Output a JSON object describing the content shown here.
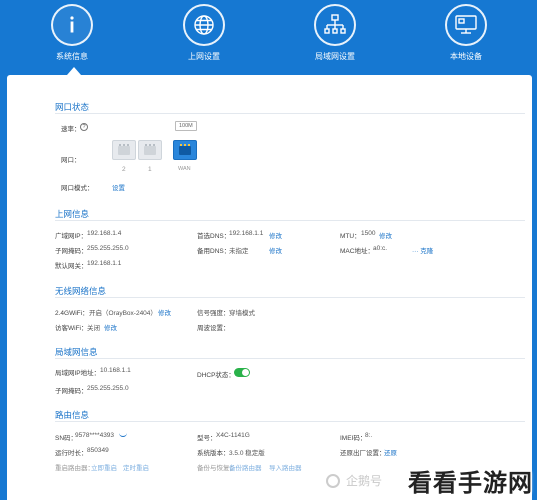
{
  "nav": {
    "items": [
      {
        "label": "系统信息",
        "icon": "info-icon",
        "active": true
      },
      {
        "label": "上网设置",
        "icon": "globe-icon"
      },
      {
        "label": "局域网设置",
        "icon": "network-icon"
      },
      {
        "label": "本地设备",
        "icon": "monitor-icon"
      }
    ]
  },
  "port_status": {
    "title": "网口状态",
    "rate_label": "速率：",
    "help": "?",
    "speed_badge": "100M",
    "port_label": "网口：",
    "ports": [
      "2",
      "1",
      "WAN"
    ],
    "mode_label": "网口模式：",
    "mode_link": "设置"
  },
  "internet": {
    "title": "上网信息",
    "wan_ip_label": "广域网IP：",
    "wan_ip": "192.168.1.4",
    "subnet_label": "子网掩码：",
    "subnet": "255.255.255.0",
    "gateway_label": "默认网关：",
    "gateway": "192.168.1.1",
    "dns1_label": "首选DNS：",
    "dns1": "192.168.1.1",
    "dns1_link": "修改",
    "dns2_label": "备用DNS：",
    "dns2": "未指定",
    "dns2_link": "修改",
    "mtu_label": "MTU：",
    "mtu": "1500",
    "mtu_link": "修改",
    "mac_label": "MAC地址：",
    "mac": "a0:c.",
    "mac_tail": "··· 克隆"
  },
  "wireless": {
    "title": "无线网络信息",
    "wifi_label": "2.4GWiFi：",
    "wifi_value": "开启（OrayBox-2404）",
    "wifi_link": "修改",
    "guest_label": "访客WiFi：",
    "guest_value": "关闭",
    "guest_link": "修改",
    "relay_label": "信号强度：",
    "relay_value": "穿墙模式",
    "weekly_label": "周波设置："
  },
  "lan": {
    "title": "局域网信息",
    "lan_ip_label": "局域网IP地址：",
    "lan_ip": "10.168.1.1",
    "lan_subnet_label": "子网掩码：",
    "lan_subnet": "255.255.255.0",
    "dhcp_label": "DHCP状态："
  },
  "router": {
    "title": "路由信息",
    "sn_label": "SN码：",
    "sn": "9578****4393",
    "model_label": "型号：",
    "model": "X4C-1141G",
    "imei_label": "IMEI码：",
    "imei": "8:.",
    "uptime_label": "运行时长：",
    "uptime": "850349",
    "version_label": "系统版本：",
    "version": "3.5.0 稳定版",
    "reset_label": "还原出厂设置：",
    "reset_link": "还原",
    "reboot_label": "重启路由器：",
    "reboot_now": "立即重启",
    "reboot_schedule": "定时重启",
    "backup_label": "备份与恢复：",
    "backup_link": "备份路由器",
    "restore_link": "导入路由器"
  },
  "watermark": {
    "left": "企鹅号",
    "right": "看看手游网"
  }
}
